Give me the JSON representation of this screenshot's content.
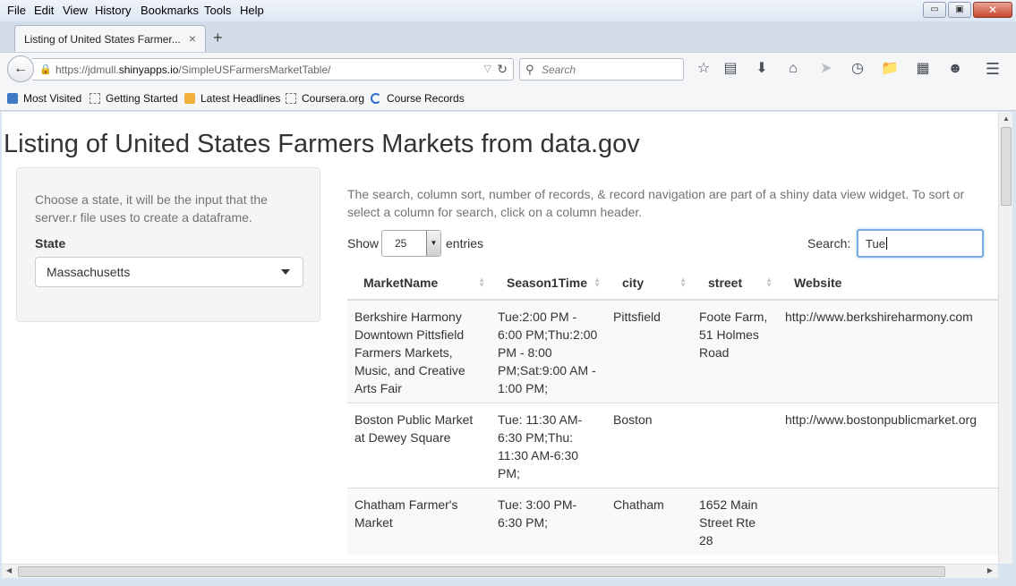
{
  "menubar": {
    "items": [
      "File",
      "Edit",
      "View",
      "History",
      "Bookmarks",
      "Tools",
      "Help"
    ]
  },
  "window_buttons": {
    "minimize": "▭",
    "restore": "▣",
    "close": "✕"
  },
  "tabs": [
    {
      "title": "Listing of United States Farmer...",
      "close": "×"
    }
  ],
  "new_tab": "+",
  "address_bar": {
    "url_prefix": "https://jdmull.",
    "url_host": "shinyapps.io",
    "url_path": "/SimpleUSFarmersMarketTable/"
  },
  "search_bar": {
    "placeholder": "Search"
  },
  "bookmarks": [
    "Most Visited",
    "Getting Started",
    "Latest Headlines",
    "Coursera.org",
    "Course Records"
  ],
  "page": {
    "title": "Listing of United States Farmers Markets from data.gov",
    "sidebar": {
      "help_text": "Choose a state, it will be the input that the server.r file uses to create a dataframe.",
      "state_label": "State",
      "state_value": "Massachusetts"
    },
    "description": "The search, column sort, number of records, & record navigation are part of a shiny data view widget. To sort or select a column for search, click on a column header.",
    "length_control": {
      "show_label": "Show",
      "value": "25",
      "entries_label": "entries"
    },
    "search": {
      "label": "Search:",
      "value": "Tue"
    },
    "table": {
      "headers": [
        "MarketName",
        "Season1Time",
        "city",
        "street",
        "Website"
      ],
      "rows": [
        {
          "market": "Berkshire Harmony Downtown Pittsfield Farmers Markets, Music, and Creative Arts Fair",
          "season": "Tue:2:00 PM - 6:00 PM;Thu:2:00 PM - 8:00 PM;Sat:9:00 AM - 1:00 PM;",
          "city": "Pittsfield",
          "street": "Foote Farm, 51 Holmes Road",
          "website": "http://www.berkshireharmony.com"
        },
        {
          "market": "Boston Public Market at Dewey Square",
          "season": "Tue: 11:30 AM-6:30 PM;Thu: 11:30 AM-6:30 PM;",
          "city": "Boston",
          "street": "",
          "website": "http://www.bostonpublicmarket.org"
        },
        {
          "market": "Chatham Farmer's Market",
          "season": "Tue: 3:00 PM-6:30 PM;",
          "city": "Chatham",
          "street": "1652 Main Street Rte 28",
          "website": ""
        }
      ]
    }
  }
}
